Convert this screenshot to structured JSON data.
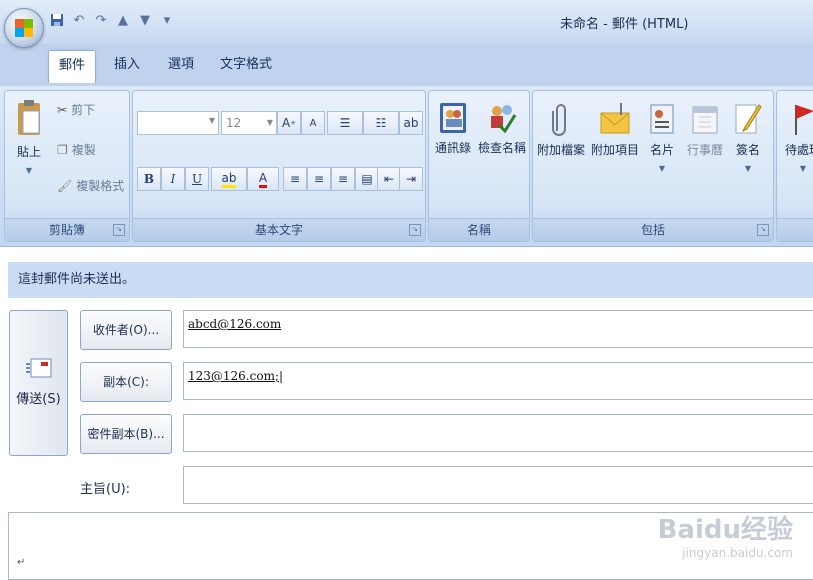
{
  "window": {
    "title": "未命名 - 郵件 (HTML)"
  },
  "quick_access": [
    "save-icon",
    "undo-icon",
    "redo-icon",
    "up-icon",
    "down-icon",
    "customize-icon"
  ],
  "tabs": [
    {
      "label": "郵件",
      "active": true
    },
    {
      "label": "插入"
    },
    {
      "label": "選項"
    },
    {
      "label": "文字格式"
    }
  ],
  "ribbon": {
    "clipboard": {
      "label": "剪貼簿",
      "paste": "貼上",
      "cut": "剪下",
      "copy": "複製",
      "format_painter": "複製格式"
    },
    "basic_text": {
      "label": "基本文字",
      "font_size": "12",
      "bold": "B",
      "italic": "I",
      "underline": "U"
    },
    "names": {
      "label": "名稱",
      "address_book": "通訊錄",
      "check_names": "檢查名稱"
    },
    "include": {
      "label": "包括",
      "attach_file": "附加檔案",
      "attach_item": "附加項目",
      "business_card": "名片",
      "calendar": "行事曆",
      "signature": "簽名"
    },
    "follow_up": {
      "label": "待處理"
    }
  },
  "infobar": {
    "text": "這封郵件尚未送出。"
  },
  "compose": {
    "send": "傳送(S)",
    "to_button": "收件者(O)...",
    "to_value": "abcd@126.com",
    "cc_button": "副本(C):",
    "cc_value": "123@126.com;",
    "bcc_button": "密件副本(B)...",
    "bcc_value": "",
    "subject_label": "主旨(U):",
    "subject_value": ""
  },
  "colors": {
    "ribbon_bg": "#c3d7f0",
    "title_bg": "#c7d9f1",
    "accent": "#f07b14"
  },
  "watermark": {
    "brand": "Baidu经验",
    "url": "jingyan.baidu.com"
  }
}
